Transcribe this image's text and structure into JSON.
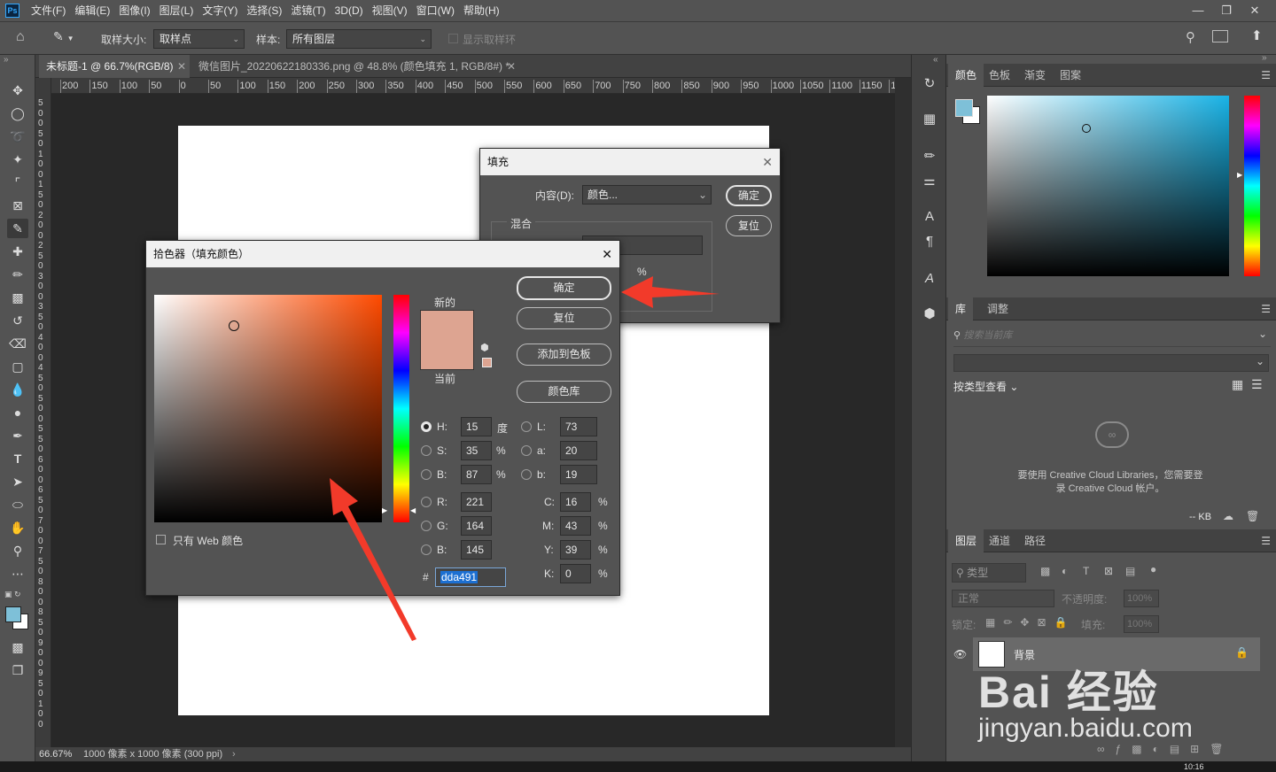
{
  "menubar": {
    "logo": "Ps",
    "items": [
      "文件(F)",
      "编辑(E)",
      "图像(I)",
      "图层(L)",
      "文字(Y)",
      "选择(S)",
      "滤镜(T)",
      "3D(D)",
      "视图(V)",
      "窗口(W)",
      "帮助(H)"
    ]
  },
  "options": {
    "sample_size_label": "取样大小:",
    "sample_size_value": "取样点",
    "sample_label": "样本:",
    "sample_value": "所有图层",
    "show_ring": "显示取样环"
  },
  "tabs": [
    {
      "label": "未标题-1 @ 66.7%(RGB/8)"
    },
    {
      "label": "微信图片_20220622180336.png @ 48.8% (颜色填充 1, RGB/8#) *"
    }
  ],
  "ruler_h": [
    "200",
    "150",
    "100",
    "50",
    "0",
    "50",
    "100",
    "150",
    "200",
    "250",
    "300",
    "350",
    "400",
    "450",
    "500",
    "550",
    "600",
    "650",
    "700",
    "750",
    "800",
    "850",
    "900",
    "950",
    "1000",
    "1050",
    "1100",
    "1150",
    "1"
  ],
  "ruler_v": [
    "5",
    "0",
    "0",
    "5",
    "0",
    "1",
    "0",
    "0",
    "1",
    "5",
    "0",
    "2",
    "0",
    "0",
    "2",
    "5",
    "0",
    "3",
    "0",
    "0",
    "3",
    "5",
    "0",
    "4",
    "0",
    "0",
    "4",
    "5",
    "0",
    "5",
    "0",
    "0",
    "5",
    "5",
    "0",
    "6",
    "0",
    "0",
    "6",
    "5",
    "0",
    "7",
    "0",
    "0",
    "7",
    "5",
    "0",
    "8",
    "0",
    "0",
    "8",
    "5",
    "0",
    "9",
    "0",
    "0",
    "9",
    "5",
    "0",
    "1",
    "0",
    "0"
  ],
  "status": {
    "zoom": "66.67%",
    "doc_info": "1000 像素 x 1000 像素 (300 ppi)"
  },
  "fill_dialog": {
    "title": "填充",
    "content_label": "内容(D):",
    "content_value": "颜色...",
    "ok": "确定",
    "reset": "复位",
    "blend_label": "混合",
    "percent": "%"
  },
  "picker": {
    "title": "拾色器（填充颜色）",
    "ok": "确定",
    "reset": "复位",
    "add_swatch": "添加到色板",
    "color_libraries": "颜色库",
    "new_label": "新的",
    "current_label": "当前",
    "web_only": "只有 Web 颜色",
    "new_color": "#dda491",
    "current_color": "#dda491",
    "fields": {
      "H": "15",
      "S": "35",
      "B": "87",
      "R": "221",
      "G": "164",
      "B2": "145",
      "L": "73",
      "a": "20",
      "b": "19",
      "C": "16",
      "M": "43",
      "Y": "39",
      "K": "0",
      "hex": "dda491"
    },
    "labels": {
      "H": "H:",
      "S": "S:",
      "B": "B:",
      "R": "R:",
      "G": "G:",
      "B2": "B:",
      "L": "L:",
      "a": "a:",
      "b": "b:",
      "C": "C:",
      "M": "M:",
      "Y": "Y:",
      "K": "K:",
      "hash": "#",
      "deg": "度",
      "pct": "%"
    }
  },
  "right": {
    "color_tabs": [
      "颜色",
      "色板",
      "渐变",
      "图案"
    ],
    "fg_color": "#7ec0d8",
    "lib_tabs": [
      "库",
      "调整"
    ],
    "lib_search_placeholder": "搜索当前库",
    "lib_view": "按类型查看",
    "lib_message": "要使用 Creative Cloud Libraries，您需要登录 Creative Cloud 帐户。",
    "lib_size": "-- KB",
    "layer_tabs": [
      "图层",
      "通道",
      "路径"
    ],
    "layer_filter": "类型",
    "blend_mode": "正常",
    "opacity_label": "不透明度:",
    "opacity_value": "100%",
    "lock_label": "锁定:",
    "fill_label": "填充:",
    "fill_value": "100%",
    "layer_name": "背景"
  },
  "watermark": {
    "brand": "Bai 经验",
    "url": "jingyan.baidu.com"
  },
  "clock": "10:16"
}
